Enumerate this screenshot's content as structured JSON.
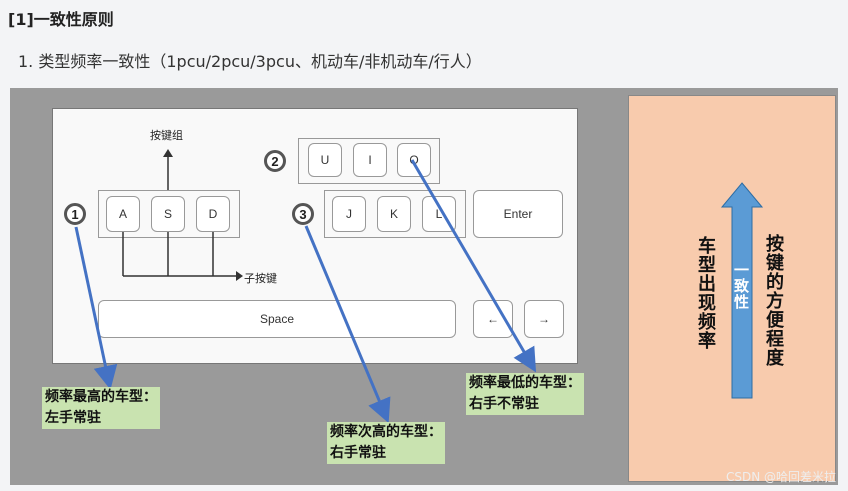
{
  "heading": "[1]一致性原则",
  "subline": "1. 类型频率一致性（1pcu/2pcu/3pcu、机动车/非机动车/行人）",
  "keyboard": {
    "label_main_keys": "按键组",
    "label_sub_keys": "子按键",
    "keys_group1": [
      "A",
      "S",
      "D"
    ],
    "keys_group2": [
      "U",
      "I",
      "O"
    ],
    "keys_group3": [
      "J",
      "K",
      "L"
    ],
    "enter": "Enter",
    "space": "Space",
    "left_arrow": "←",
    "right_arrow": "→",
    "circle1": "1",
    "circle2": "2",
    "circle3": "3"
  },
  "callouts": {
    "high": [
      "频率最高的车型：",
      "左手常驻"
    ],
    "mid": [
      "频率次高的车型：",
      "右手常驻"
    ],
    "low": [
      "频率最低的车型：",
      "右手不常驻"
    ]
  },
  "panel": {
    "left_text": "车型出现频率",
    "arrow_text": "一致性",
    "right_text": "按键的方便程度"
  },
  "colors": {
    "arrow_blue": "#4472c4",
    "panel_bg": "#f8cbad",
    "callout_bg": "#c9e3b0",
    "figure_bg": "#9a9a9a"
  },
  "watermark": "CSDN @哈回差米拉"
}
